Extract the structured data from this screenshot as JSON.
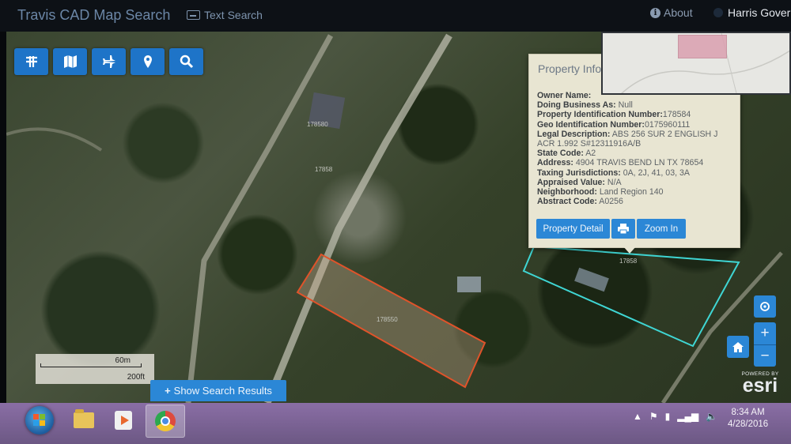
{
  "header": {
    "app_title": "Travis CAD Map Search",
    "text_search": "Text Search",
    "about": "About",
    "user": "Harris Gover"
  },
  "toolbar": {
    "buttons": [
      "filter-icon",
      "map-icon",
      "airplane-icon",
      "location-pin-icon",
      "search-icon"
    ]
  },
  "popup": {
    "title": "Property Info",
    "fields": [
      {
        "label": "Owner Name:",
        "value": ""
      },
      {
        "label": "Doing Business As:",
        "value": "Null"
      },
      {
        "label": "Property Identification Number:",
        "value": "178584"
      },
      {
        "label": "Geo Identification Number:",
        "value": "0175960111"
      },
      {
        "label": "Legal Description:",
        "value": "ABS 256 SUR 2 ENGLISH J ACR 1.992 S#12311916A/B"
      },
      {
        "label": "State Code:",
        "value": "A2"
      },
      {
        "label": "Address:",
        "value": "4904 TRAVIS BEND LN TX 78654"
      },
      {
        "label": "Taxing Jurisdictions:",
        "value": "0A, 2J, 41, 03, 3A"
      },
      {
        "label": "Appraised Value:",
        "value": "N/A"
      },
      {
        "label": "Neighborhood:",
        "value": "Land Region 140"
      },
      {
        "label": "Abstract Code:",
        "value": "A0256"
      }
    ],
    "property_detail": "Property Detail",
    "zoom_in": "Zoom In"
  },
  "map": {
    "parcel_labels": [
      "178580",
      "17858",
      "178550",
      "17858"
    ],
    "zoom_in": "+",
    "zoom_out": "−",
    "scale_metric": "60m",
    "scale_imperial": "200ft",
    "show_results": "Show Search Results",
    "powered_by": "POWERED BY",
    "esri": "esri",
    "colors": {
      "highlight": "#e0532a",
      "selected": "#3fd6d4",
      "button": "#2b87d6"
    }
  },
  "taskbar": {
    "time": "8:34 AM",
    "date": "4/28/2016"
  }
}
